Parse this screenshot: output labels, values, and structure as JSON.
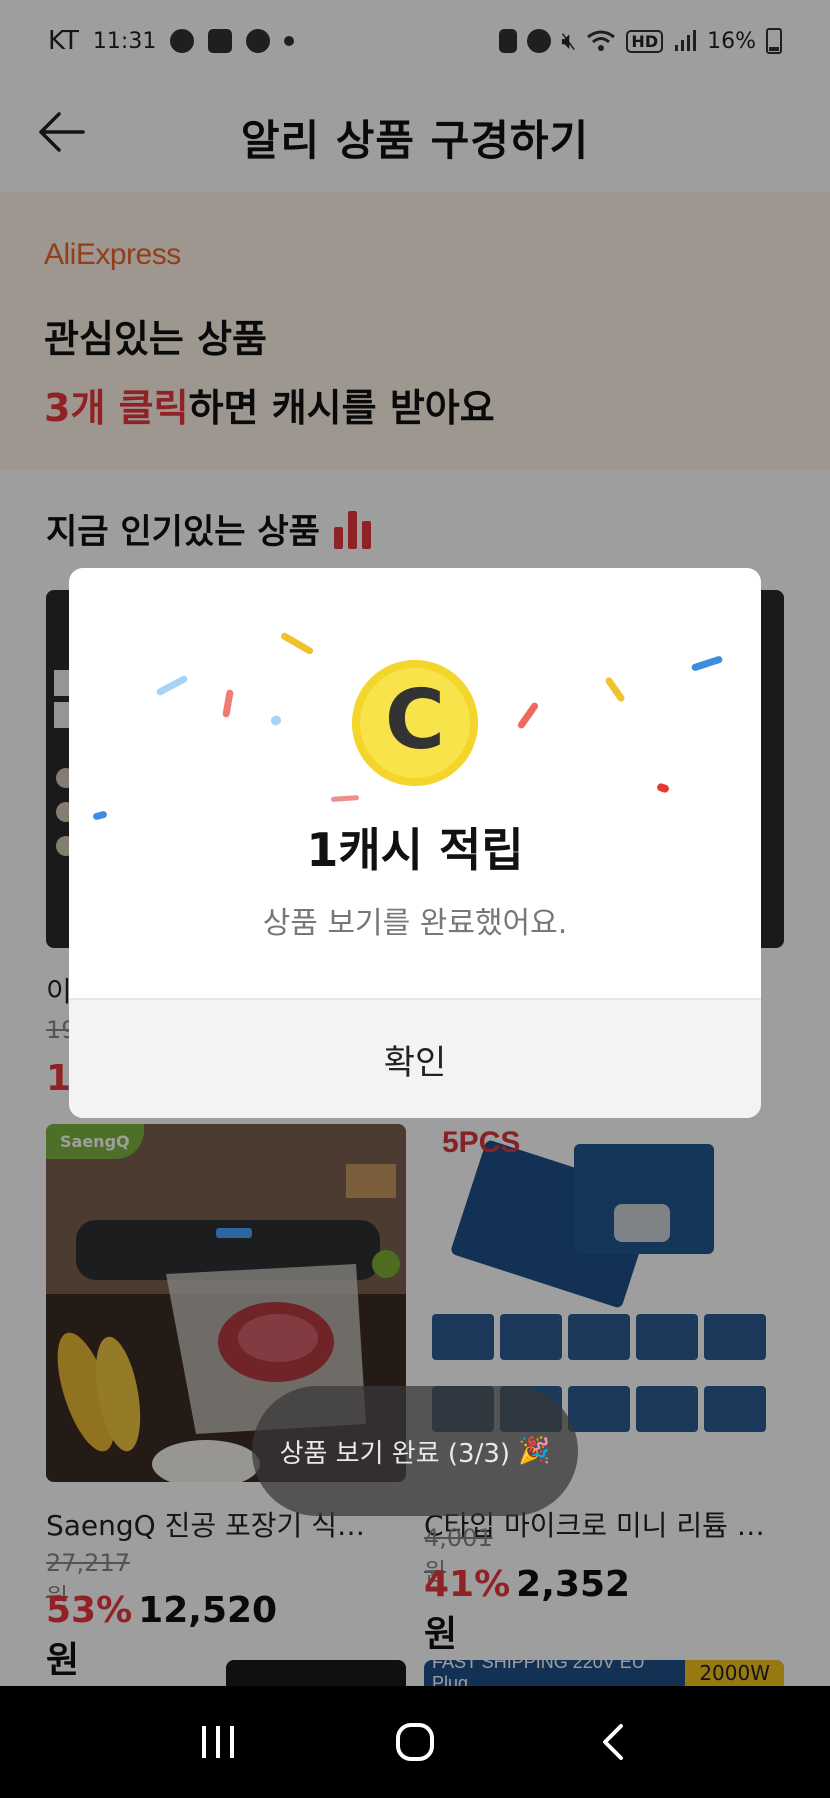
{
  "status": {
    "carrier": "KT",
    "time": "11:31",
    "net": "HD",
    "battery": "16%"
  },
  "header": {
    "title": "알리 상품 구경하기"
  },
  "banner": {
    "logo": "AliExpress",
    "line1": "관심있는 상품",
    "line2_highlight": "3개 클릭",
    "line2_rest": "하면 캐시를 받아요"
  },
  "section": {
    "title": "지금 인기있는 상품"
  },
  "products": [
    {
      "name": "이",
      "orig": "19",
      "pct": "1",
      "price": ""
    },
    {
      "name": "SaengQ 진공 포장기 식품 진…",
      "orig": "27,217원",
      "pct": "53%",
      "price": "12,520원",
      "badge": "SaengQ"
    },
    {
      "name": "C타입 마이크로 미니 리튬 배터…",
      "orig": "4,001원",
      "pct": "41%",
      "price": "2,352원",
      "badge": "5PCS"
    },
    {
      "name": "",
      "orig": "",
      "pct": "",
      "price": "",
      "badge": "FAST SHIPPING 220V EU Plug",
      "badge2": "2000W"
    }
  ],
  "modal": {
    "coin": "C",
    "title": "1캐시 적립",
    "message": "상품 보기를 완료했어요.",
    "confirm": "확인"
  },
  "toast": {
    "text": "상품 보기 완료 (3/3)",
    "emoji": "🎉"
  },
  "colors": {
    "accent": "#e8383d",
    "brand_orange": "#e8662a",
    "coin_yellow": "#f8e44a",
    "banner_bg": "#fdf4e8"
  }
}
